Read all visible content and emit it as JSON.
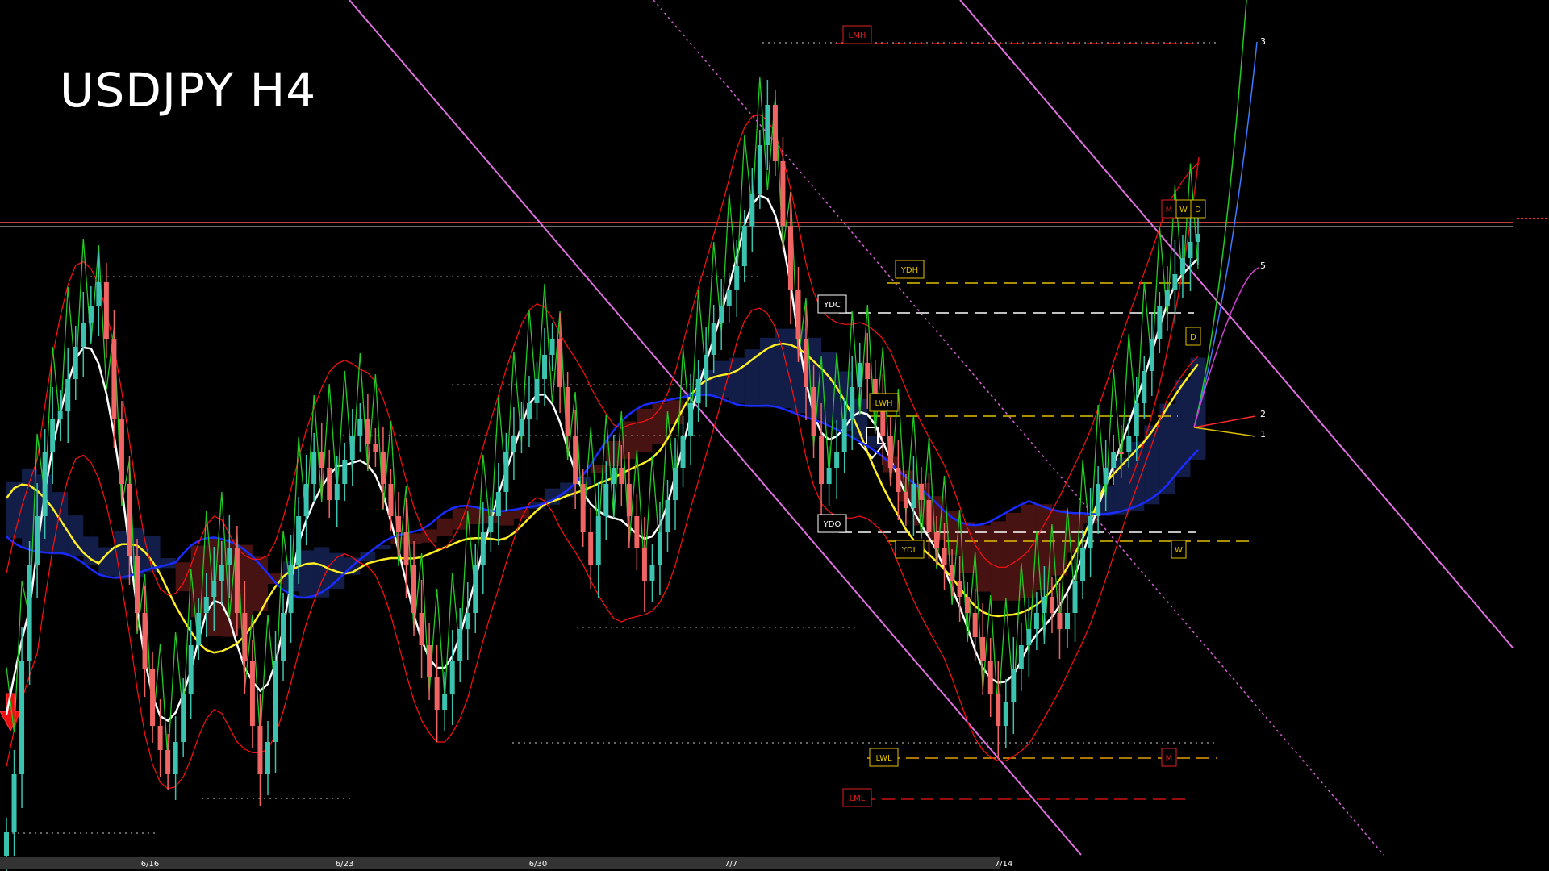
{
  "chart_title": "USDJPY H4",
  "colors": {
    "background": "#000000",
    "bull": "#3cc3b0",
    "bear": "#f06464",
    "white_ma": "#ffffff",
    "yellow_ma": "#ffee22",
    "blue_ma": "#1a2bff",
    "envelope": "#ff1010",
    "green_line": "#22cc22",
    "channel": "#e070e0",
    "cloud_bear": "#cc3333",
    "cloud_bull": "#3355cc",
    "label_red": "#e02020",
    "label_yellow": "#e0c000"
  },
  "chart_data": {
    "type": "candlestick",
    "y_range": [
      0,
      1080
    ],
    "x_dates": [
      "6/16",
      "6/23",
      "6/30",
      "7/7",
      "7/14"
    ],
    "candles_close": [
      1032,
      960,
      820,
      700,
      640,
      560,
      520,
      510,
      470,
      430,
      400,
      380,
      350,
      420,
      520,
      600,
      690,
      760,
      830,
      900,
      930,
      960,
      920,
      860,
      800,
      760,
      740,
      720,
      700,
      680,
      760,
      820,
      900,
      960,
      920,
      820,
      760,
      700,
      640,
      600,
      560,
      580,
      620,
      600,
      570,
      540,
      520,
      550,
      560,
      600,
      640,
      660,
      700,
      760,
      800,
      840,
      880,
      860,
      820,
      780,
      760,
      700,
      660,
      640,
      610,
      560,
      540,
      520,
      500,
      470,
      440,
      420,
      480,
      540,
      600,
      660,
      700,
      640,
      600,
      580,
      600,
      640,
      680,
      720,
      700,
      660,
      620,
      580,
      540,
      500,
      470,
      440,
      400,
      380,
      360,
      330,
      280,
      240,
      180,
      130,
      200,
      280,
      360,
      420,
      480,
      540,
      600,
      580,
      560,
      520,
      480,
      450,
      470,
      500,
      540,
      580,
      610,
      630,
      600,
      620,
      660,
      680,
      700,
      720,
      740,
      760,
      790,
      820,
      860,
      900,
      870,
      830,
      800,
      780,
      760,
      740,
      760,
      780,
      760,
      720,
      680,
      640,
      600,
      580,
      560,
      560,
      540,
      500,
      460,
      420,
      380,
      360,
      340,
      320,
      300,
      290
    ],
    "levels": [
      {
        "label": "LMH",
        "y": 54
      },
      {
        "label": "M",
        "y": 270
      },
      {
        "label": "W",
        "y": 270
      },
      {
        "label": "D",
        "y": 270
      },
      {
        "label": "YDH",
        "y": 345
      },
      {
        "label": "YDC",
        "y": 388
      },
      {
        "label": "D",
        "y": 428
      },
      {
        "label": "LWH",
        "y": 510
      },
      {
        "label": "YDO",
        "y": 660
      },
      {
        "label": "YDL",
        "y": 692
      },
      {
        "label": "W",
        "y": 692
      },
      {
        "label": "LWL",
        "y": 950
      },
      {
        "label": "M",
        "y": 950
      },
      {
        "label": "LML",
        "y": 1000
      }
    ],
    "projection_labels": [
      "3",
      "5",
      "2",
      "1"
    ]
  }
}
